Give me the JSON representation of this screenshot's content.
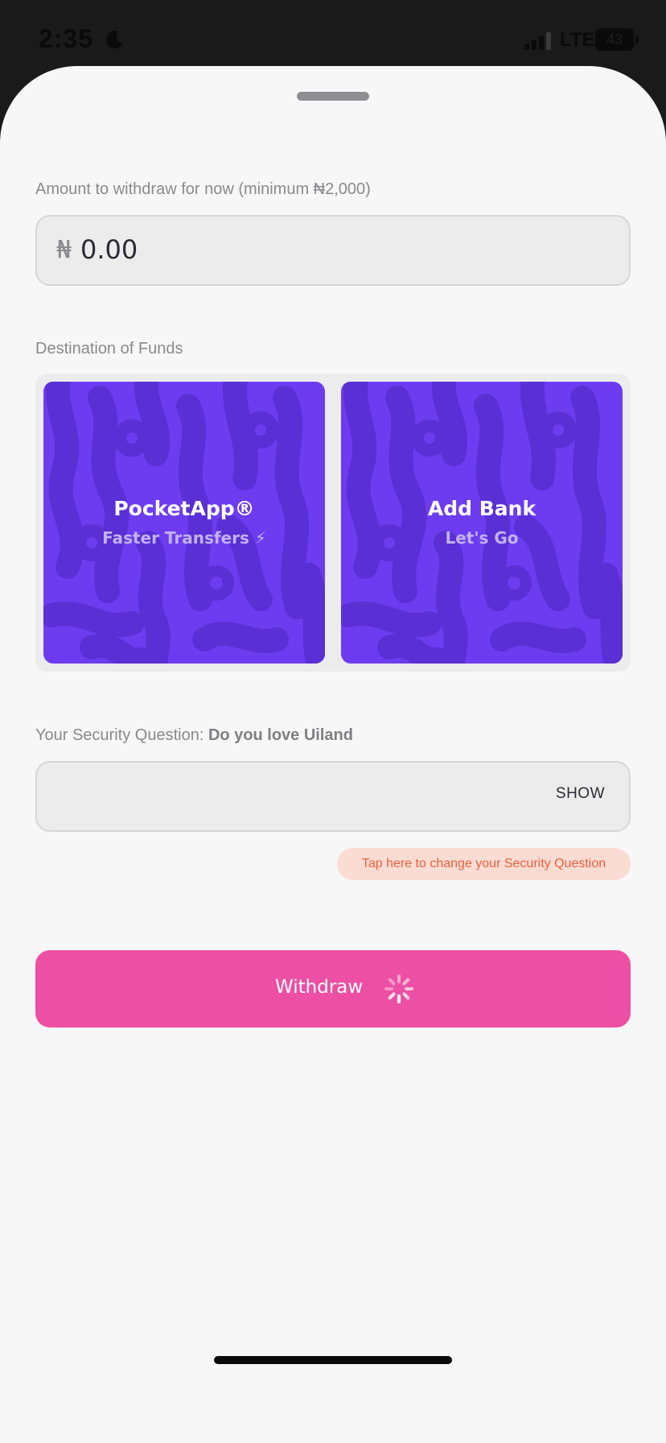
{
  "status_bar": {
    "time": "2:35",
    "network": "LTE",
    "battery": "43"
  },
  "withdraw_form": {
    "amount_label": "Amount to withdraw for now (minimum ₦2,000)",
    "currency_symbol": "₦",
    "amount_value": "0.00",
    "destination_label": "Destination of Funds",
    "destinations": [
      {
        "title": "PocketApp®",
        "subtitle": "Faster Transfers ⚡"
      },
      {
        "title": "Add Bank",
        "subtitle": "Let's Go"
      }
    ],
    "security_question_prefix": "Your Security Question: ",
    "security_question": "Do you love Uiland",
    "answer_value": "",
    "show_label": "SHOW",
    "change_question_label": "Tap here to change your Security Question",
    "withdraw_label": "Withdraw"
  },
  "colors": {
    "card_purple": "#6d3cf0",
    "button_pink": "#ec4fa3",
    "pill_bg": "#fbdcd3",
    "pill_text": "#e8603c"
  },
  "icons": [
    "moon-icon",
    "signal-icon",
    "battery-icon",
    "spinner-icon"
  ]
}
